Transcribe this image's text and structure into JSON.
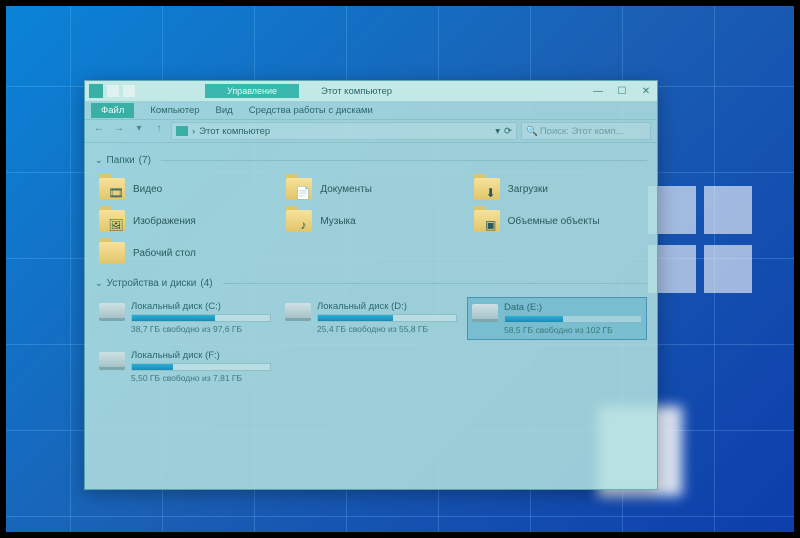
{
  "titlebar": {
    "contextual_tab": "Управление",
    "window_title": "Этот компьютер",
    "min": "—",
    "max": "☐",
    "close": "✕"
  },
  "ribbon": {
    "file": "Файл",
    "tabs": [
      "Компьютер",
      "Вид",
      "Средства работы с дисками"
    ]
  },
  "address": {
    "location_label": "Этот компьютер",
    "search_placeholder": "Поиск: Этот комп..."
  },
  "groups": {
    "folders": {
      "label": "Папки",
      "count": 7,
      "items": [
        {
          "label": "Видео",
          "glyph": "🎞"
        },
        {
          "label": "Документы",
          "glyph": "📄"
        },
        {
          "label": "Загрузки",
          "glyph": "⬇"
        },
        {
          "label": "Изображения",
          "glyph": "🖼"
        },
        {
          "label": "Музыка",
          "glyph": "♪"
        },
        {
          "label": "Объемные объекты",
          "glyph": "▣"
        },
        {
          "label": "Рабочий стол",
          "glyph": ""
        }
      ]
    },
    "drives": {
      "label": "Устройства и диски",
      "count": 4,
      "items": [
        {
          "name": "Локальный диск (C:)",
          "free_label": "38,7 ГБ свободно из 97,6 ГБ",
          "used_pct": 60,
          "selected": false
        },
        {
          "name": "Локальный диск (D:)",
          "free_label": "25,4 ГБ свободно из 55,8 ГБ",
          "used_pct": 54,
          "selected": false
        },
        {
          "name": "Data (E:)",
          "free_label": "58,5 ГБ свободно из 102 ГБ",
          "used_pct": 43,
          "selected": true
        },
        {
          "name": "Локальный диск (F:)",
          "free_label": "5,50 ГБ свободно из 7,81 ГБ",
          "used_pct": 30,
          "selected": false
        }
      ]
    }
  }
}
